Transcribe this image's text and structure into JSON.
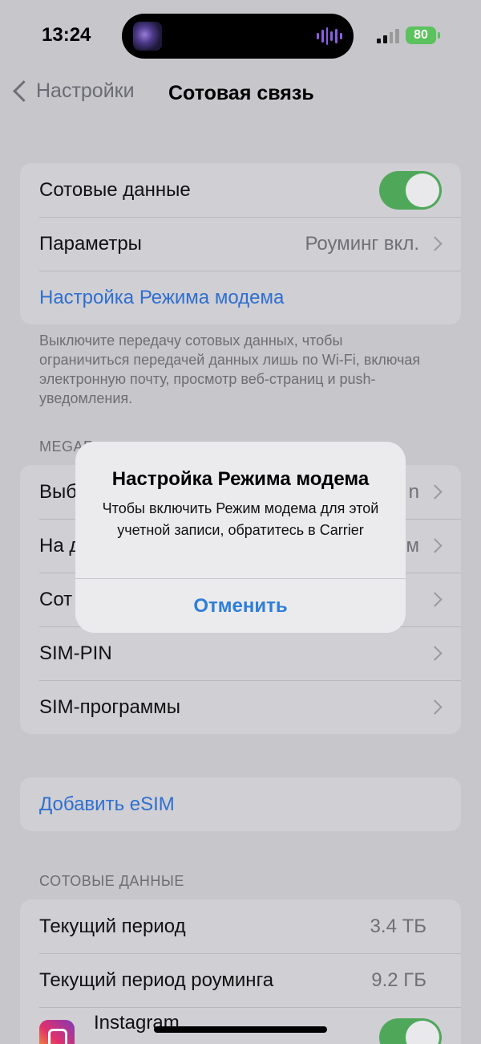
{
  "status_bar": {
    "time": "13:24",
    "battery": "80",
    "icons": [
      "now-playing-artwork",
      "audio-waveform-icon",
      "cellular-signal-icon",
      "battery-charging-icon"
    ]
  },
  "nav": {
    "back_label": "Настройки",
    "title": "Сотовая связь"
  },
  "top_group": {
    "cellular_data_label": "Сотовые данные",
    "cellular_data_on": true,
    "options_label": "Параметры",
    "options_value": "Роуминг вкл.",
    "hotspot_setup_label": "Настройка Режима модема"
  },
  "footnote": "Выключите передачу сотовых данных, чтобы ограничиться передачей данных лишь по Wi-Fi, включая электронную почту, просмотр веб-страниц и push-уведомления.",
  "carrier_section": {
    "header": "MEGAF",
    "items": [
      {
        "label": "Выб",
        "value": "n"
      },
      {
        "label": "На д",
        "value": "м"
      },
      {
        "label": "Сот",
        "value": ""
      },
      {
        "label": "SIM-PIN",
        "value": ""
      },
      {
        "label": "SIM-программы",
        "value": ""
      }
    ]
  },
  "esim": {
    "add_label": "Добавить eSIM"
  },
  "usage_section": {
    "header": "СОТОВЫЕ ДАННЫЕ",
    "current_period_label": "Текущий период",
    "current_period_value": "3.4 ТБ",
    "roaming_period_label": "Текущий период роуминга",
    "roaming_period_value": "9.2 ГБ",
    "app_name": "Instagram",
    "app_enabled": true
  },
  "alert": {
    "title": "Настройка Режима модема",
    "message": "Чтобы включить Режим модема для этой учетной записи, обратитесь в Carrier",
    "cancel_label": "Отменить"
  },
  "colors": {
    "accent_blue": "#2f7ed8",
    "toggle_green": "#4fa85a",
    "battery_green": "#5bc25e"
  }
}
